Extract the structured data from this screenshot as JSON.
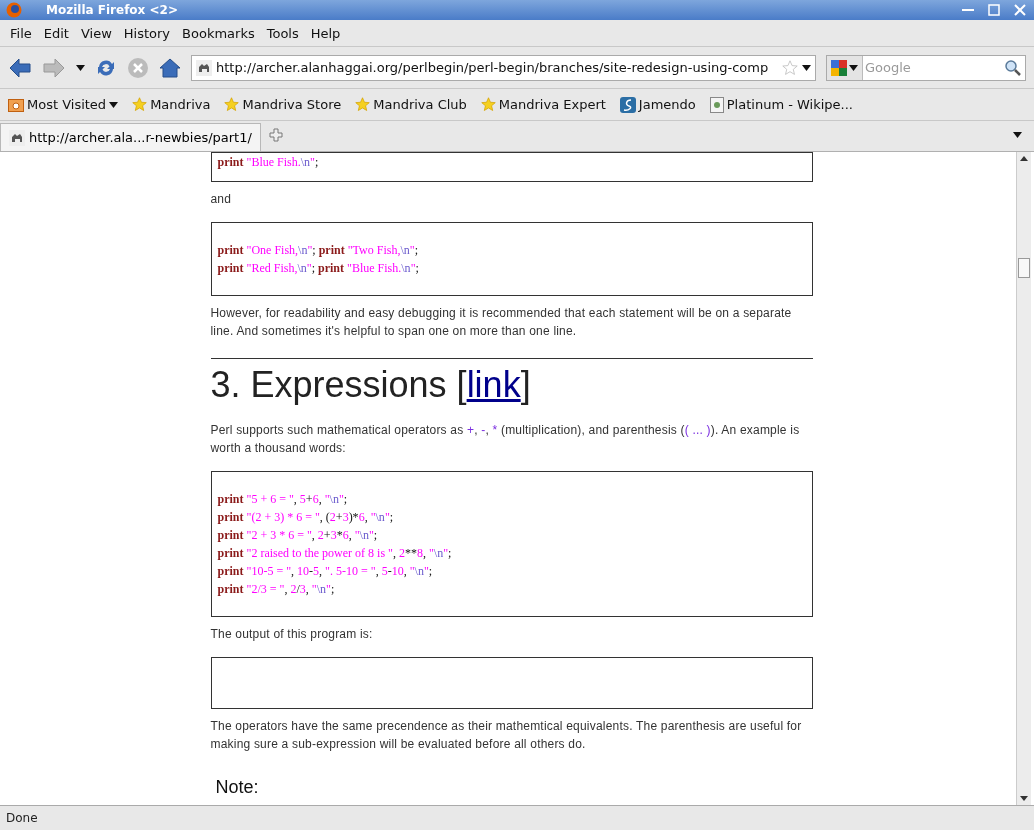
{
  "window": {
    "title": "Mozilla Firefox <2>"
  },
  "menu": [
    "File",
    "Edit",
    "View",
    "History",
    "Bookmarks",
    "Tools",
    "Help"
  ],
  "nav": {
    "back_disabled": false,
    "forward_disabled": true,
    "stop_disabled": true,
    "url": "http://archer.alanhaggai.org/perlbegin/perl-begin/branches/site-redesign-using-comp",
    "search_placeholder": "Google"
  },
  "bookmarks": [
    {
      "label": "Most Visited",
      "kind": "folder"
    },
    {
      "label": "Mandriva",
      "kind": "star"
    },
    {
      "label": "Mandriva Store",
      "kind": "star"
    },
    {
      "label": "Mandriva Club",
      "kind": "star"
    },
    {
      "label": "Mandriva Expert",
      "kind": "star"
    },
    {
      "label": "Jamendo",
      "kind": "site"
    },
    {
      "label": "Platinum - Wikipe...",
      "kind": "page"
    }
  ],
  "tabs": [
    {
      "label": "http://archer.ala...r-newbies/part1/",
      "selected": true
    }
  ],
  "content": [
    {
      "kind": "code",
      "lines": [
        [
          {
            "kind": "keyword",
            "text": "print"
          },
          {
            "kind": "string",
            "text": " \"Blue Fish."
          },
          {
            "kind": "escape",
            "text": "\\n"
          },
          {
            "kind": "string",
            "text": "\""
          },
          {
            "kind": "plain",
            "text": ";"
          }
        ]
      ]
    },
    {
      "kind": "para",
      "parts": [
        {
          "kind": "plain",
          "text": "and"
        }
      ]
    },
    {
      "kind": "code",
      "lines": [
        [
          {
            "kind": "keyword",
            "text": "print"
          },
          {
            "kind": "string",
            "text": " \"One Fish,"
          },
          {
            "kind": "escape",
            "text": "\\n"
          },
          {
            "kind": "string",
            "text": "\""
          },
          {
            "kind": "plain",
            "text": "; "
          },
          {
            "kind": "keyword",
            "text": "print"
          },
          {
            "kind": "string",
            "text": " \"Two Fish,"
          },
          {
            "kind": "escape",
            "text": "\\n"
          },
          {
            "kind": "string",
            "text": "\""
          },
          {
            "kind": "plain",
            "text": ";"
          }
        ],
        [
          {
            "kind": "keyword",
            "text": "print"
          },
          {
            "kind": "string",
            "text": " \"Red Fish,"
          },
          {
            "kind": "escape",
            "text": "\\n"
          },
          {
            "kind": "string",
            "text": "\""
          },
          {
            "kind": "plain",
            "text": "; "
          },
          {
            "kind": "keyword",
            "text": "print"
          },
          {
            "kind": "string",
            "text": " \"Blue Fish."
          },
          {
            "kind": "escape",
            "text": "\\n"
          },
          {
            "kind": "string",
            "text": "\""
          },
          {
            "kind": "plain",
            "text": ";"
          }
        ]
      ]
    },
    {
      "kind": "para",
      "parts": [
        {
          "kind": "plain",
          "text": "However, for readability and easy debugging it is recommended that each statement will be on a separate line. And sometimes it's helpful to span one on more than one line."
        }
      ]
    },
    {
      "kind": "rule"
    },
    {
      "kind": "heading",
      "text": "3. Expressions [",
      "link": "link",
      "after": "]"
    },
    {
      "kind": "para",
      "parts": [
        {
          "kind": "plain",
          "text": "Perl supports such mathematical operators as "
        },
        {
          "kind": "op",
          "text": "+"
        },
        {
          "kind": "plain",
          "text": ", "
        },
        {
          "kind": "op",
          "text": "-"
        },
        {
          "kind": "plain",
          "text": ", "
        },
        {
          "kind": "op",
          "text": "*"
        },
        {
          "kind": "plain",
          "text": " (multiplication), and parenthesis ("
        },
        {
          "kind": "op",
          "text": "( ... )"
        },
        {
          "kind": "plain",
          "text": "). An example is worth a thousand words:"
        }
      ]
    },
    {
      "kind": "code",
      "lines": [
        [
          {
            "kind": "keyword",
            "text": "print"
          },
          {
            "kind": "string",
            "text": " \"5 + 6 = \""
          },
          {
            "kind": "plain",
            "text": ", "
          },
          {
            "kind": "number",
            "text": "5"
          },
          {
            "kind": "plain",
            "text": "+"
          },
          {
            "kind": "number",
            "text": "6"
          },
          {
            "kind": "plain",
            "text": ", "
          },
          {
            "kind": "string",
            "text": "\""
          },
          {
            "kind": "escape",
            "text": "\\n"
          },
          {
            "kind": "string",
            "text": "\""
          },
          {
            "kind": "plain",
            "text": ";"
          }
        ],
        [
          {
            "kind": "keyword",
            "text": "print"
          },
          {
            "kind": "string",
            "text": " \"(2 + 3) * 6 = \""
          },
          {
            "kind": "plain",
            "text": ", ("
          },
          {
            "kind": "number",
            "text": "2"
          },
          {
            "kind": "plain",
            "text": "+"
          },
          {
            "kind": "number",
            "text": "3"
          },
          {
            "kind": "plain",
            "text": ")*"
          },
          {
            "kind": "number",
            "text": "6"
          },
          {
            "kind": "plain",
            "text": ", "
          },
          {
            "kind": "string",
            "text": "\""
          },
          {
            "kind": "escape",
            "text": "\\n"
          },
          {
            "kind": "string",
            "text": "\""
          },
          {
            "kind": "plain",
            "text": ";"
          }
        ],
        [
          {
            "kind": "keyword",
            "text": "print"
          },
          {
            "kind": "string",
            "text": " \"2 + 3 * 6 = \""
          },
          {
            "kind": "plain",
            "text": ", "
          },
          {
            "kind": "number",
            "text": "2"
          },
          {
            "kind": "plain",
            "text": "+"
          },
          {
            "kind": "number",
            "text": "3"
          },
          {
            "kind": "plain",
            "text": "*"
          },
          {
            "kind": "number",
            "text": "6"
          },
          {
            "kind": "plain",
            "text": ", "
          },
          {
            "kind": "string",
            "text": "\""
          },
          {
            "kind": "escape",
            "text": "\\n"
          },
          {
            "kind": "string",
            "text": "\""
          },
          {
            "kind": "plain",
            "text": ";"
          }
        ],
        [
          {
            "kind": "keyword",
            "text": "print"
          },
          {
            "kind": "string",
            "text": " \"2 raised to the power of 8 is \""
          },
          {
            "kind": "plain",
            "text": ", "
          },
          {
            "kind": "number",
            "text": "2"
          },
          {
            "kind": "plain",
            "text": "**"
          },
          {
            "kind": "number",
            "text": "8"
          },
          {
            "kind": "plain",
            "text": ", "
          },
          {
            "kind": "string",
            "text": "\""
          },
          {
            "kind": "escape",
            "text": "\\n"
          },
          {
            "kind": "string",
            "text": "\""
          },
          {
            "kind": "plain",
            "text": ";"
          }
        ],
        [
          {
            "kind": "keyword",
            "text": "print"
          },
          {
            "kind": "string",
            "text": " \"10-5 = \""
          },
          {
            "kind": "plain",
            "text": ", "
          },
          {
            "kind": "number",
            "text": "10"
          },
          {
            "kind": "plain",
            "text": "-"
          },
          {
            "kind": "number",
            "text": "5"
          },
          {
            "kind": "plain",
            "text": ", "
          },
          {
            "kind": "string",
            "text": "\". 5-10 = \""
          },
          {
            "kind": "plain",
            "text": ", "
          },
          {
            "kind": "number",
            "text": "5"
          },
          {
            "kind": "plain",
            "text": "-"
          },
          {
            "kind": "number",
            "text": "10"
          },
          {
            "kind": "plain",
            "text": ", "
          },
          {
            "kind": "string",
            "text": "\""
          },
          {
            "kind": "escape",
            "text": "\\n"
          },
          {
            "kind": "string",
            "text": "\""
          },
          {
            "kind": "plain",
            "text": ";"
          }
        ],
        [
          {
            "kind": "keyword",
            "text": "print"
          },
          {
            "kind": "string",
            "text": " \"2/3 = \""
          },
          {
            "kind": "plain",
            "text": ", "
          },
          {
            "kind": "number",
            "text": "2"
          },
          {
            "kind": "plain",
            "text": "/"
          },
          {
            "kind": "number",
            "text": "3"
          },
          {
            "kind": "plain",
            "text": ", "
          },
          {
            "kind": "string",
            "text": "\""
          },
          {
            "kind": "escape",
            "text": "\\n"
          },
          {
            "kind": "string",
            "text": "\""
          },
          {
            "kind": "plain",
            "text": ";"
          }
        ]
      ]
    },
    {
      "kind": "para",
      "parts": [
        {
          "kind": "plain",
          "text": "The output of this program is:"
        }
      ]
    },
    {
      "kind": "output"
    },
    {
      "kind": "para",
      "parts": [
        {
          "kind": "plain",
          "text": "The operators have the same precendence as their mathemtical equivalents. The parenthesis are useful for making sure a sub-expression will be evaluated before all others do."
        }
      ]
    },
    {
      "kind": "subheading",
      "text": "Note:"
    }
  ],
  "status_bar": {
    "text": "Done"
  }
}
